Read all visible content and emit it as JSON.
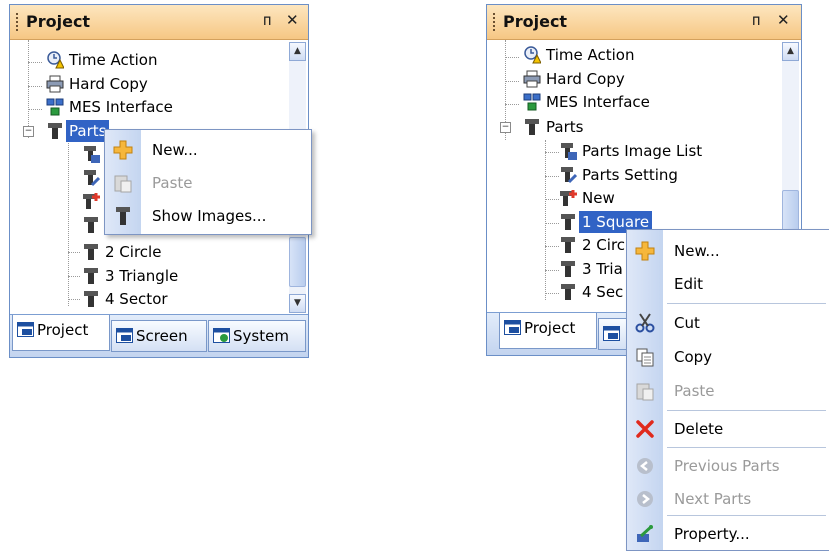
{
  "left_panel": {
    "title": "Project",
    "pin_glyph": "ᴨ",
    "close_glyph": "✕",
    "tree": [
      "Time Action",
      "Hard Copy",
      "MES Interface",
      "Parts",
      "2 Circle",
      "3 Triangle",
      "4 Sector"
    ],
    "tabs": [
      "Project",
      "Screen",
      "System"
    ],
    "menu": {
      "new": "New...",
      "paste": "Paste",
      "show_images": "Show Images..."
    }
  },
  "right_panel": {
    "title": "Project",
    "pin_glyph": "ᴨ",
    "close_glyph": "✕",
    "tree": [
      "Time Action",
      "Hard Copy",
      "MES Interface",
      "Parts",
      "Parts Image List",
      "Parts Setting",
      "New",
      "1 Square",
      "2 Circ",
      "3 Tria",
      "4 Sec"
    ],
    "tabs": [
      "Project"
    ],
    "menu": {
      "new": "New...",
      "edit": "Edit",
      "cut": "Cut",
      "copy": "Copy",
      "paste": "Paste",
      "delete": "Delete",
      "previous_parts": "Previous Parts",
      "next_parts": "Next Parts",
      "property": "Property..."
    }
  },
  "colors": {
    "title_bar": "#f6c784",
    "selection": "#3163c5",
    "gutter": "#c4d5f0"
  }
}
